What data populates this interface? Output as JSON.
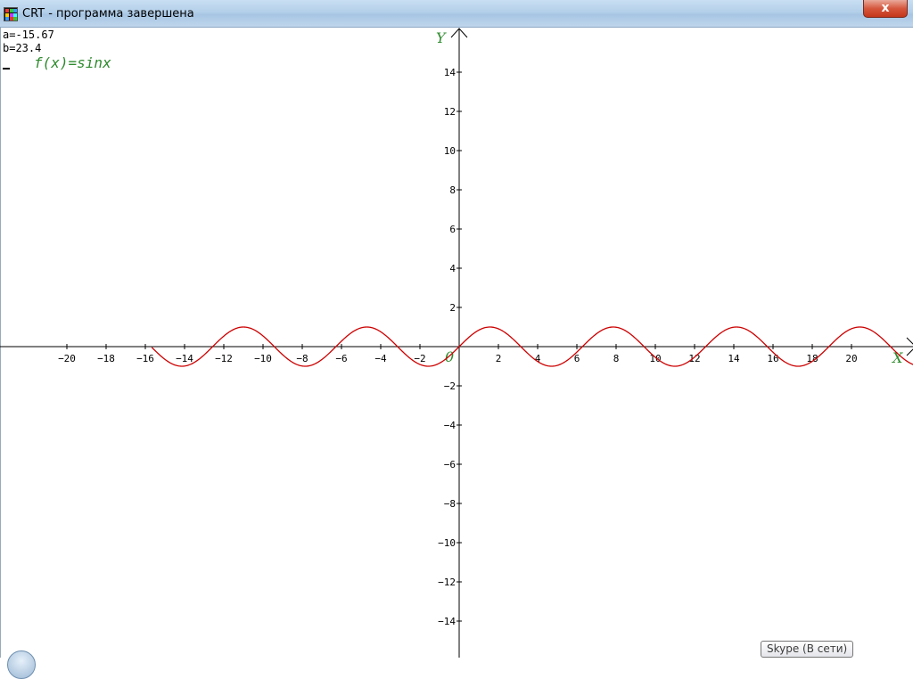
{
  "window": {
    "title": "CRT - программа завершена",
    "close_label": "x"
  },
  "console": {
    "line_a": "a=-15.67",
    "line_b": "b=23.4"
  },
  "function_label": "f(x)=sinx",
  "chart_data": {
    "type": "line",
    "title": "f(x)=sinx",
    "xlabel": "X",
    "ylabel": "Y",
    "origin_label": "0",
    "xlim": [
      -23.2,
      23.0
    ],
    "ylim": [
      -15.5,
      15.5
    ],
    "x_ticks": [
      -20,
      -18,
      -16,
      -14,
      -12,
      -10,
      -8,
      -6,
      -4,
      -2,
      2,
      4,
      6,
      8,
      10,
      12,
      14,
      16,
      18,
      20
    ],
    "y_ticks": [
      14,
      12,
      10,
      8,
      6,
      4,
      2,
      -2,
      -4,
      -6,
      -8,
      -10,
      -12,
      -14
    ],
    "series": [
      {
        "function": "sin(x)",
        "x_start": -15.67,
        "x_end": 23.4,
        "color": "#cc0000"
      }
    ],
    "axis_color": "#000000",
    "label_color": "#2e8b2e"
  },
  "taskbar": {
    "tooltip": "Skype (В сети)"
  }
}
